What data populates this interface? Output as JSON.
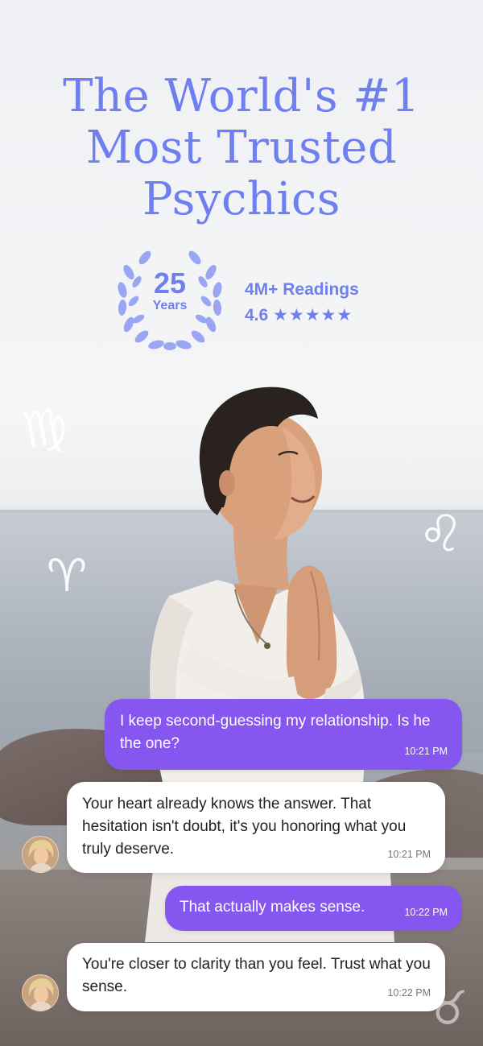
{
  "headline": {
    "line1": "The World's #1",
    "line2": "Most Trusted",
    "line3": "Psychics"
  },
  "badge": {
    "years_number": "25",
    "years_label": "Years",
    "readings": "4M+ Readings",
    "rating_value": "4.6",
    "rating_stars": "★★★★★",
    "rating": 4.6,
    "rating_max": 5
  },
  "zodiac": {
    "virgo": "♍",
    "leo": "♌",
    "aries": "♈",
    "taurus": "♉"
  },
  "chat": {
    "messages": [
      {
        "from": "user",
        "text": "I keep second-guessing my relationship. Is he the one?",
        "time": "10:21 PM"
      },
      {
        "from": "psychic",
        "text": "Your heart already knows the answer. That hesitation isn't doubt, it's you honoring what you truly deserve.",
        "time": "10:21 PM"
      },
      {
        "from": "user",
        "text": "That actually makes sense.",
        "time": "10:22 PM"
      },
      {
        "from": "psychic",
        "text": "You're closer to clarity than you feel. Trust what you sense.",
        "time": "10:22 PM"
      }
    ]
  },
  "colors": {
    "headline": "#6f7ff0",
    "user_bubble": "#8656f1",
    "psychic_bubble": "#ffffff"
  },
  "icons": {
    "laurel": "laurel-wreath-icon",
    "star": "star-icon"
  }
}
